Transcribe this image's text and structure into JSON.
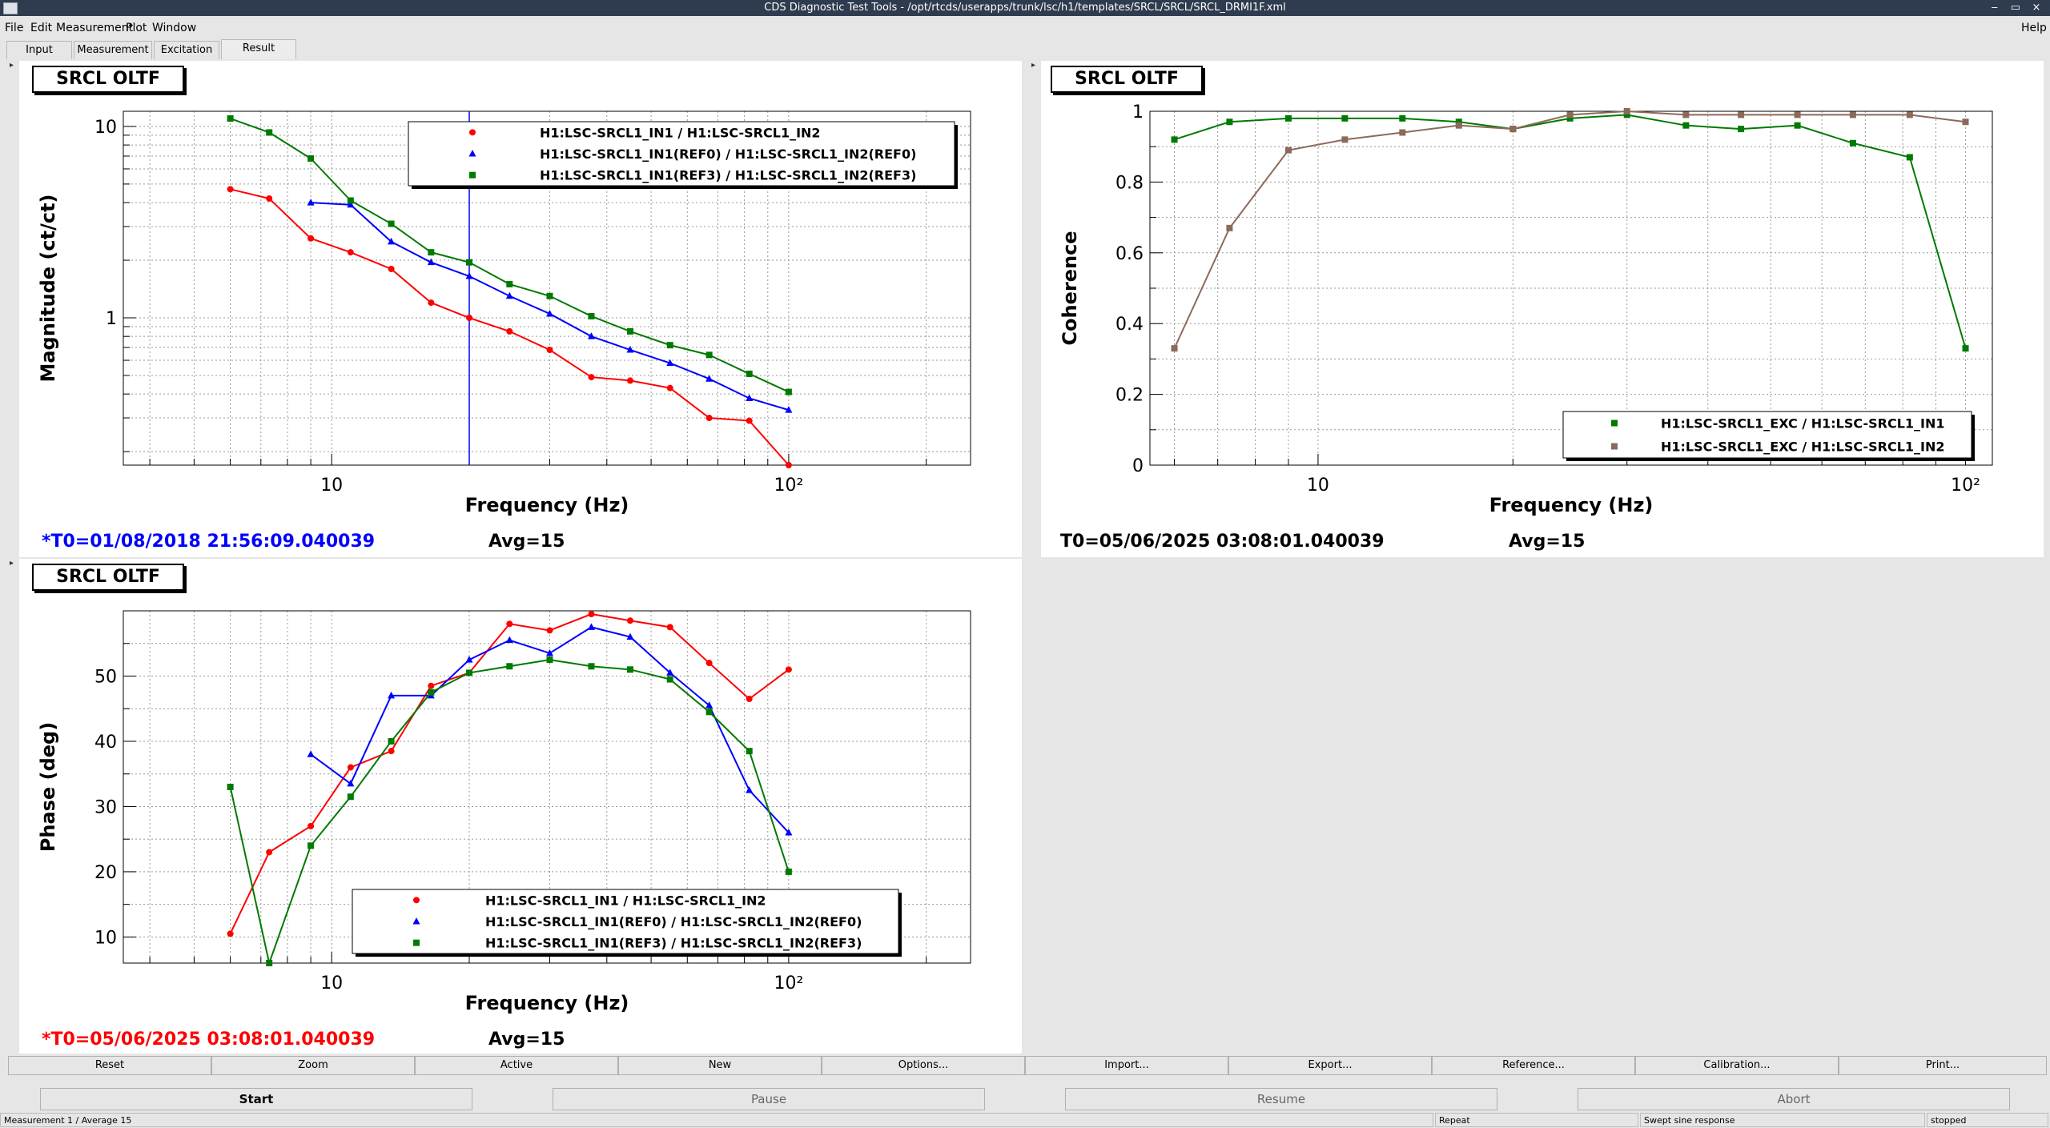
{
  "window": {
    "title": "CDS Diagnostic Test Tools - /opt/rtcds/userapps/trunk/lsc/h1/templates/SRCL/SRCL/SRCL_DRMI1F.xml",
    "controls": [
      "‒",
      "▭",
      "×"
    ]
  },
  "menu": {
    "items": [
      "File",
      "Edit",
      "Measurement",
      "Plot",
      "Window"
    ],
    "help": "Help"
  },
  "tabs": [
    "Input",
    "Measurement",
    "Excitation",
    "Result"
  ],
  "colors": {
    "red": "#ff0000",
    "blue": "#0000ff",
    "green": "#007a00",
    "brown": "#8b6a5a",
    "t0_blue": "#0000ff",
    "t0_red": "#ff0000"
  },
  "plots": [
    {
      "title": "SRCL OLTF",
      "t0": "*T0=01/08/2018 21:56:09.040039",
      "avg": "Avg=15"
    },
    {
      "title": "SRCL OLTF",
      "t0": "T0=05/06/2025 03:08:01.040039",
      "avg": "Avg=15"
    },
    {
      "title": "SRCL OLTF",
      "t0": "*T0=05/06/2025 03:08:01.040039",
      "avg": "Avg=15"
    }
  ],
  "chart_data": [
    {
      "type": "line",
      "xlabel": "Frequency (Hz)",
      "ylabel": "Magnitude (ct/ct)",
      "xscale": "log",
      "yscale": "log",
      "xlim": [
        3.5,
        250
      ],
      "ylim": [
        0.17,
        12
      ],
      "ytick_labels": [
        "10",
        "1"
      ],
      "xtick_labels": [
        "10",
        "10²"
      ],
      "grid": true,
      "cursor_x": 20,
      "legend_placement": "top-right",
      "series": [
        {
          "name": "H1:LSC-SRCL1_IN1 / H1:LSC-SRCL1_IN2",
          "color": "#ff0000",
          "marker": "circle",
          "x": [
            6,
            7.3,
            9,
            11,
            13.5,
            16.5,
            20,
            24.5,
            30,
            37,
            45,
            55,
            67,
            82,
            100
          ],
          "y": [
            4.7,
            4.2,
            2.6,
            2.2,
            1.8,
            1.2,
            1.0,
            0.85,
            0.68,
            0.49,
            0.47,
            0.43,
            0.3,
            0.29,
            0.17
          ]
        },
        {
          "name": "H1:LSC-SRCL1_IN1(REF0) / H1:LSC-SRCL1_IN2(REF0)",
          "color": "#0000ff",
          "marker": "triangle",
          "x": [
            9,
            11,
            13.5,
            16.5,
            20,
            24.5,
            30,
            37,
            45,
            55,
            67,
            82,
            100
          ],
          "y": [
            4.0,
            3.9,
            2.5,
            1.95,
            1.65,
            1.3,
            1.05,
            0.8,
            0.68,
            0.58,
            0.48,
            0.38,
            0.33
          ]
        },
        {
          "name": "H1:LSC-SRCL1_IN1(REF3) / H1:LSC-SRCL1_IN2(REF3)",
          "color": "#007a00",
          "marker": "square",
          "x": [
            6,
            7.3,
            9,
            11,
            13.5,
            16.5,
            20,
            24.5,
            30,
            37,
            45,
            55,
            67,
            82,
            100
          ],
          "y": [
            11,
            9.3,
            6.8,
            4.1,
            3.1,
            2.2,
            1.95,
            1.5,
            1.3,
            1.02,
            0.85,
            0.72,
            0.64,
            0.51,
            0.41
          ]
        }
      ]
    },
    {
      "type": "line",
      "xlabel": "Frequency (Hz)",
      "ylabel": "Coherence",
      "xscale": "log",
      "xlim": [
        5.5,
        110
      ],
      "ylim": [
        0,
        1
      ],
      "ytick_labels": [
        "0",
        "0.2",
        "0.4",
        "0.6",
        "0.8",
        "1"
      ],
      "xtick_labels": [
        "10",
        "10²"
      ],
      "grid": true,
      "legend_placement": "bottom-right",
      "series": [
        {
          "name": "H1:LSC-SRCL1_EXC / H1:LSC-SRCL1_IN1",
          "color": "#007a00",
          "marker": "square",
          "x": [
            6,
            7.3,
            9,
            11,
            13.5,
            16.5,
            20,
            24.5,
            30,
            37,
            45,
            55,
            67,
            82,
            100
          ],
          "y": [
            0.92,
            0.97,
            0.98,
            0.98,
            0.98,
            0.97,
            0.95,
            0.98,
            0.99,
            0.96,
            0.95,
            0.96,
            0.91,
            0.87,
            0.33
          ]
        },
        {
          "name": "H1:LSC-SRCL1_EXC / H1:LSC-SRCL1_IN2",
          "color": "#8b6a5a",
          "marker": "square",
          "x": [
            6,
            7.3,
            9,
            11,
            13.5,
            16.5,
            20,
            24.5,
            30,
            37,
            45,
            55,
            67,
            82,
            100
          ],
          "y": [
            0.33,
            0.67,
            0.89,
            0.92,
            0.94,
            0.96,
            0.95,
            0.99,
            1.0,
            0.99,
            0.99,
            0.99,
            0.99,
            0.99,
            0.97
          ]
        }
      ]
    },
    {
      "type": "line",
      "xlabel": "Frequency (Hz)",
      "ylabel": "Phase (deg)",
      "xscale": "log",
      "xlim": [
        3.5,
        250
      ],
      "ylim": [
        6,
        60
      ],
      "ytick_labels": [
        "10",
        "20",
        "30",
        "40",
        "50"
      ],
      "xtick_labels": [
        "10",
        "10²"
      ],
      "grid": true,
      "legend_placement": "bottom-center",
      "series": [
        {
          "name": "H1:LSC-SRCL1_IN1 / H1:LSC-SRCL1_IN2",
          "color": "#ff0000",
          "marker": "circle",
          "x": [
            6,
            7.3,
            9,
            11,
            13.5,
            16.5,
            20,
            24.5,
            30,
            37,
            45,
            55,
            67,
            82,
            100
          ],
          "y": [
            10.5,
            23,
            27,
            36,
            38.5,
            48.5,
            50.5,
            58,
            57,
            59.5,
            58.5,
            57.5,
            52,
            46.5,
            51
          ]
        },
        {
          "name": "H1:LSC-SRCL1_IN1(REF0) / H1:LSC-SRCL1_IN2(REF0)",
          "color": "#0000ff",
          "marker": "triangle",
          "x": [
            9,
            11,
            13.5,
            16.5,
            20,
            24.5,
            30,
            37,
            45,
            55,
            67,
            82,
            100
          ],
          "y": [
            38,
            33.5,
            47,
            47,
            52.5,
            55.5,
            53.5,
            57.5,
            56,
            50.5,
            45.5,
            32.5,
            26
          ]
        },
        {
          "name": "H1:LSC-SRCL1_IN1(REF3) / H1:LSC-SRCL1_IN2(REF3)",
          "color": "#007a00",
          "marker": "square",
          "x": [
            6,
            7.3,
            9,
            11,
            13.5,
            16.5,
            20,
            24.5,
            30,
            37,
            45,
            55,
            67,
            82,
            100
          ],
          "y": [
            33,
            6,
            24,
            31.5,
            40,
            47.5,
            50.5,
            51.5,
            52.5,
            51.5,
            51,
            49.5,
            44.5,
            38.5,
            20
          ]
        }
      ]
    }
  ],
  "buttons": [
    "Reset",
    "Zoom",
    "Active",
    "New",
    "Options...",
    "Import...",
    "Export...",
    "Reference...",
    "Calibration...",
    "Print..."
  ],
  "controls": [
    "Start",
    "Pause",
    "Resume",
    "Abort"
  ],
  "statusbar": [
    "Measurement 1 / Average 15",
    "Repeat",
    "Swept sine response",
    "stopped"
  ]
}
